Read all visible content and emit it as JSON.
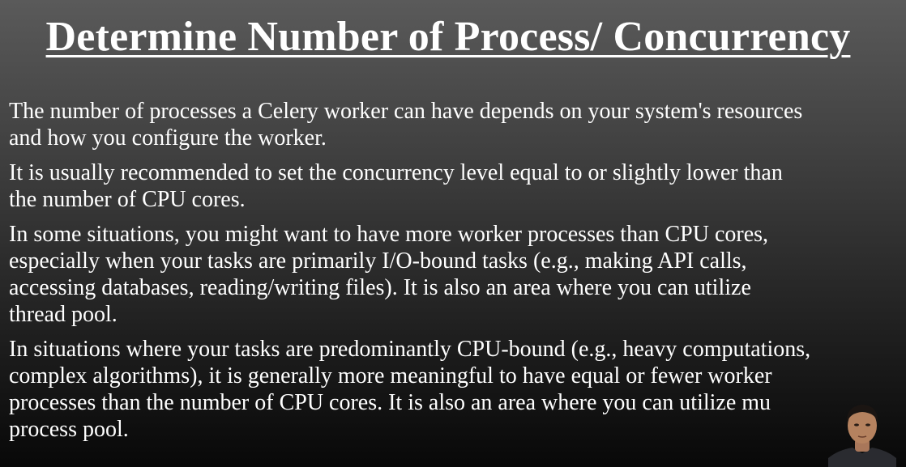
{
  "slide": {
    "title": "Determine Number of Process/ Concurrency",
    "paragraphs": [
      "The number of processes a Celery worker can have depends on your system's resources\nand how you configure the worker.",
      "It is usually recommended to set the concurrency level equal to or slightly lower than\nthe number of CPU cores.",
      "In some situations, you might want to have more worker processes than CPU cores,\nespecially when your tasks are primarily I/O-bound tasks (e.g., making API calls,\naccessing databases, reading/writing files). It is also an area where you can utilize\nthread pool.",
      "In situations where your tasks are predominantly CPU-bound (e.g., heavy computations,\ncomplex algorithms), it is generally more meaningful to have equal or fewer worker\nprocesses than the number of CPU cores. It is also an area where you can utilize mu\nprocess pool."
    ]
  },
  "colors": {
    "background_top": "#5a5a5a",
    "background_bottom": "#080808",
    "text": "#ffffff"
  },
  "icons": {
    "presenter": "presenter-webcam-icon"
  }
}
